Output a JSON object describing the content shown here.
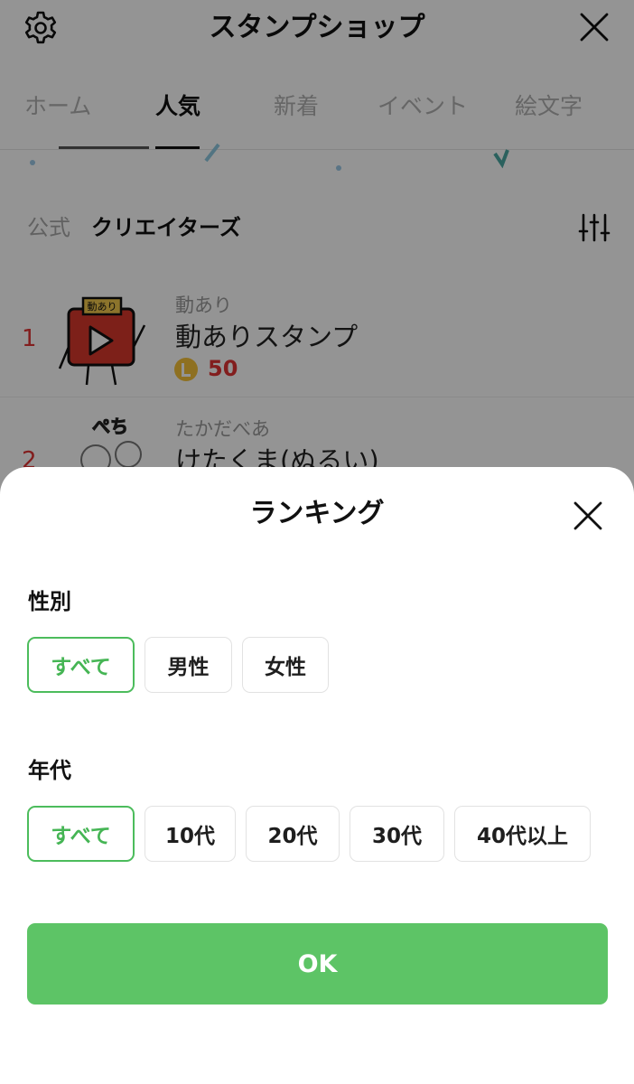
{
  "header": {
    "title": "スタンプショップ",
    "settings_icon": "gear-icon",
    "close_icon": "close-icon"
  },
  "tabs": [
    {
      "label": "ホーム",
      "active": false
    },
    {
      "label": "人気",
      "active": true
    },
    {
      "label": "新着",
      "active": false
    },
    {
      "label": "イベント",
      "active": false
    },
    {
      "label": "絵文字",
      "active": false
    }
  ],
  "subfilter": {
    "items": [
      {
        "label": "公式",
        "active": false
      },
      {
        "label": "クリエイターズ",
        "active": true
      }
    ],
    "filter_icon": "sliders-icon"
  },
  "ranking_list": [
    {
      "rank": "1",
      "author": "動あり",
      "name": "動ありスタンプ",
      "price": "50",
      "thumb_label": "動あり"
    },
    {
      "rank": "2",
      "author": "たかだべあ",
      "name": "けたくま(ぬるい)",
      "thumb_label": "ぺち"
    }
  ],
  "sheet": {
    "title": "ランキング",
    "close_icon": "close-icon",
    "gender": {
      "label": "性別",
      "options": [
        "すべて",
        "男性",
        "女性"
      ],
      "selected": "すべて"
    },
    "age": {
      "label": "年代",
      "options": [
        "すべて",
        "10代",
        "20代",
        "30代",
        "40代以上"
      ],
      "selected": "すべて"
    },
    "ok_label": "OK"
  },
  "colors": {
    "accent_green": "#5dc466",
    "selected_chip_text": "#45b554",
    "rank_red": "#e03434",
    "coin_gold": "#f5c23a"
  }
}
